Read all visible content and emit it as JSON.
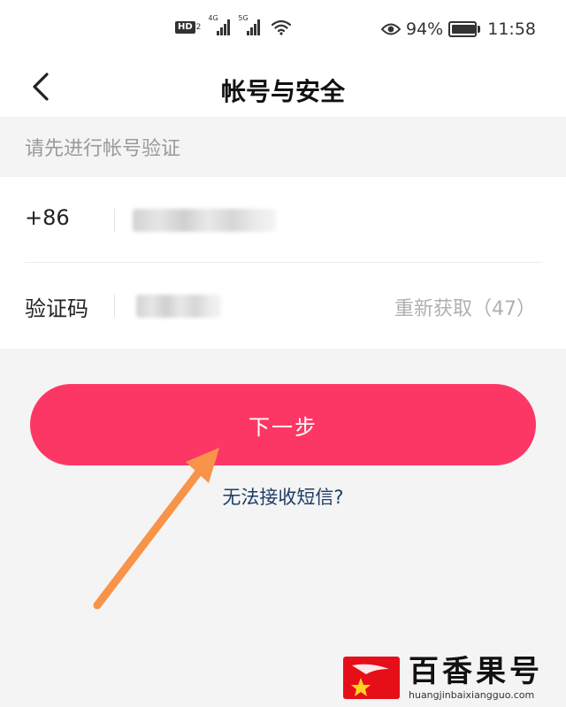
{
  "status_bar": {
    "hd_label": "HD",
    "hd_sub": "2",
    "network_1": "4G",
    "network_2": "5G",
    "battery_percent": "94%",
    "time": "11:58",
    "icons": [
      "hd-icon",
      "signal-icon",
      "wifi-icon",
      "eye-icon",
      "battery-icon"
    ]
  },
  "header": {
    "back_icon": "chevron-left-icon",
    "title": "帐号与安全"
  },
  "hint": "请先进行帐号验证",
  "form": {
    "phone": {
      "country_code": "+86"
    },
    "code": {
      "label": "验证码",
      "resend_label": "重新获取（47）"
    }
  },
  "actions": {
    "next_label": "下一步",
    "sms_link": "无法接收短信?"
  },
  "annotation": {
    "arrow_icon": "arrow-icon",
    "arrow_color": "#f7944a"
  },
  "watermark": {
    "title": "百香果号",
    "url": "huangjinbaixiangguo.com"
  },
  "colors": {
    "accent": "#fd3765",
    "link": "#1d3c66",
    "hint_text": "#9a9a9a",
    "logo_red": "#e60e19"
  }
}
